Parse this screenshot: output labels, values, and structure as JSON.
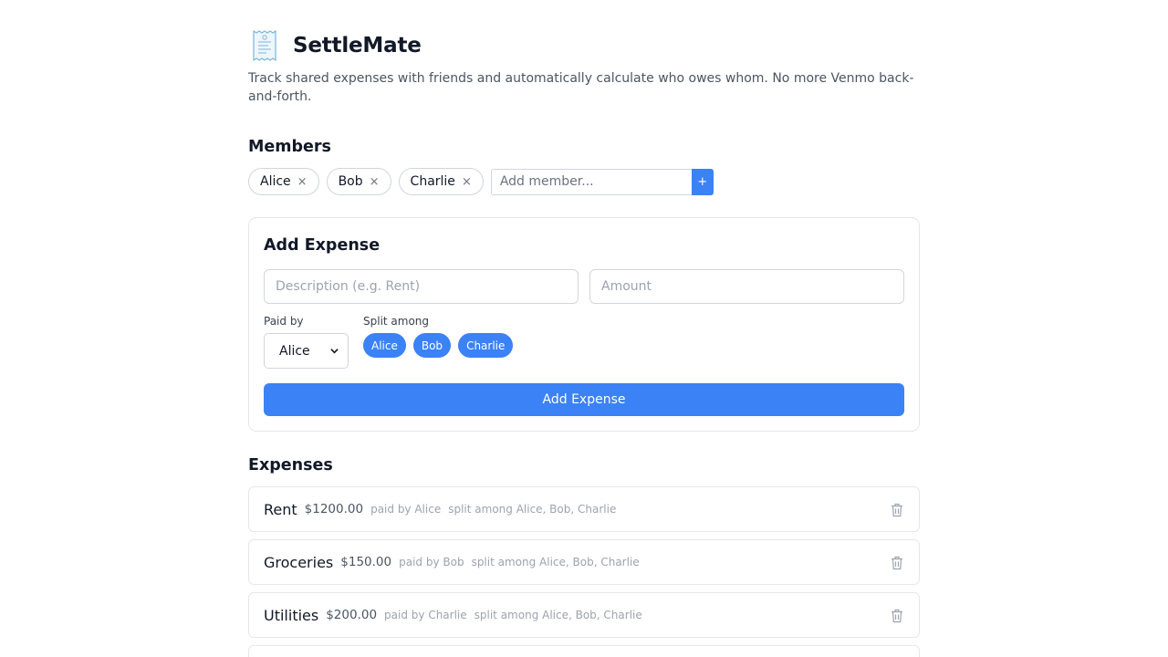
{
  "app": {
    "title": "SettleMate",
    "tagline": "Track shared expenses with friends and automatically calculate who owes whom. No more Venmo back-and-forth.",
    "logo_icon": "receipt-icon"
  },
  "members": {
    "heading": "Members",
    "list": [
      {
        "name": "Alice",
        "remove": "×"
      },
      {
        "name": "Bob",
        "remove": "×"
      },
      {
        "name": "Charlie",
        "remove": "×"
      }
    ],
    "input_placeholder": "Add member...",
    "add_label": "+"
  },
  "add_expense": {
    "heading": "Add Expense",
    "description_placeholder": "Description (e.g. Rent)",
    "amount_placeholder": "Amount",
    "paid_by_label": "Paid by",
    "paid_by_value": "Alice",
    "split_label": "Split among",
    "split_members": [
      "Alice",
      "Bob",
      "Charlie"
    ],
    "submit_label": "Add Expense"
  },
  "expenses": {
    "heading": "Expenses",
    "items": [
      {
        "name": "Rent",
        "amount": "$1200.00",
        "paid_by": "paid by Alice",
        "split": "split among Alice, Bob, Charlie"
      },
      {
        "name": "Groceries",
        "amount": "$150.00",
        "paid_by": "paid by Bob",
        "split": "split among Alice, Bob, Charlie"
      },
      {
        "name": "Utilities",
        "amount": "$200.00",
        "paid_by": "paid by Charlie",
        "split": "split among Alice, Bob, Charlie"
      }
    ]
  },
  "colors": {
    "accent": "#3b82f6",
    "text": "#111827",
    "muted": "#9ca3af",
    "border": "#e5e7eb"
  }
}
